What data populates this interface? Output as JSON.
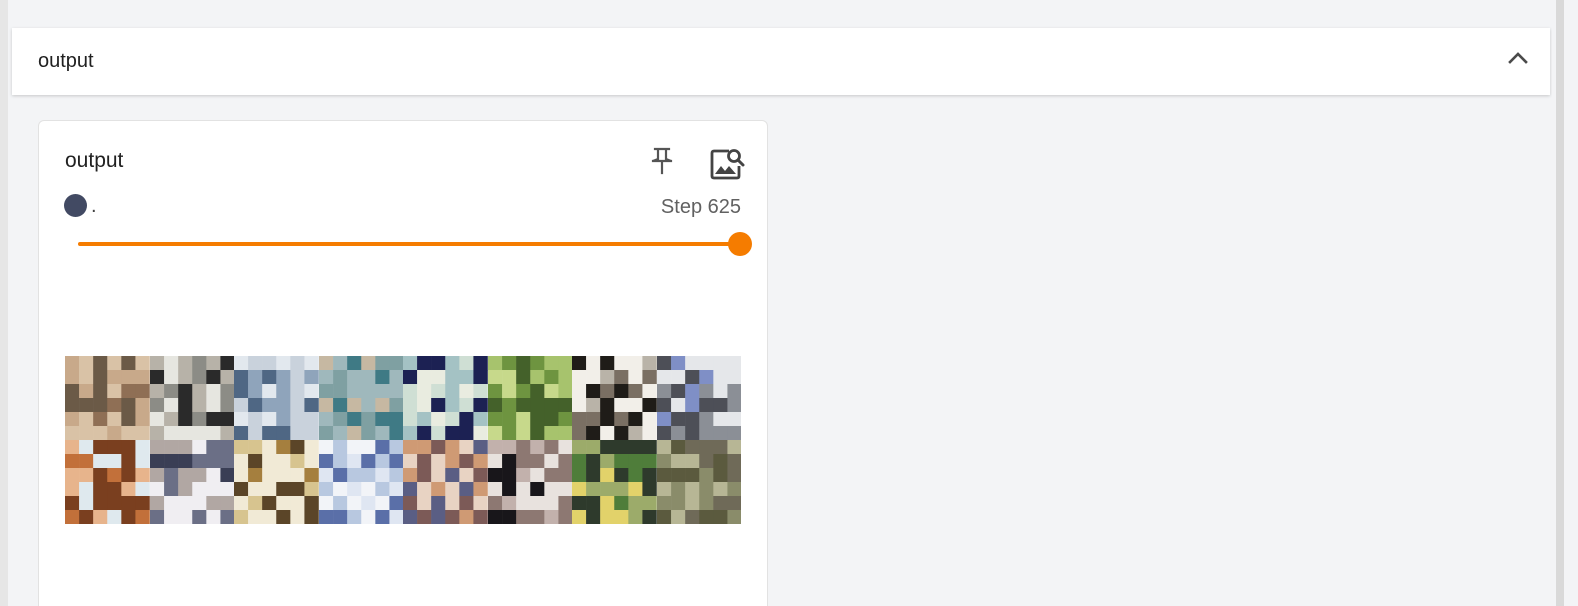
{
  "group": {
    "title": "output",
    "collapse_icon": "chevron-up-icon"
  },
  "card": {
    "title": "output",
    "pin_icon": "pin-icon",
    "zoom_icon": "image-search-icon",
    "run": {
      "label": ".",
      "color": "#424a63"
    },
    "step_label": "Step 625",
    "slider": {
      "value_fraction": 1.0,
      "color": "#f57c00"
    },
    "image": {
      "rows": 2,
      "cols": 8,
      "palettes": [
        [
          "#c8a98a",
          "#8f6f55",
          "#d9c2a6",
          "#6b5a47"
        ],
        [
          "#2a2a2a",
          "#e6e6e0",
          "#8c8c86",
          "#b7b2a8"
        ],
        [
          "#c9d2dc",
          "#8fa4bb",
          "#e2e8ee",
          "#4f6784"
        ],
        [
          "#7fa0a2",
          "#3f7a85",
          "#c6b8a2",
          "#9fb8bc"
        ],
        [
          "#cfdfd4",
          "#a4c2c4",
          "#1c2153",
          "#e9ece0"
        ],
        [
          "#a7c36d",
          "#6e9440",
          "#c7d98b",
          "#44612a"
        ],
        [
          "#1f1c18",
          "#f2efe9",
          "#7a6f63",
          "#b9b3a8"
        ],
        [
          "#7f8fc6",
          "#e5e7ea",
          "#8b8f96",
          "#4d4f57"
        ],
        [
          "#c2703a",
          "#7a3f1f",
          "#e7b48c",
          "#dfe9ee"
        ],
        [
          "#f0eef2",
          "#6b6f86",
          "#b1a7a3",
          "#3a3e55"
        ],
        [
          "#a57f3e",
          "#d7c48f",
          "#5b4528",
          "#f1ead6"
        ],
        [
          "#f2f4f8",
          "#b8c8e0",
          "#5a6fa8",
          "#dfe6f2"
        ],
        [
          "#cf9a74",
          "#7c5a57",
          "#e8d3c3",
          "#5a5e84"
        ],
        [
          "#18161a",
          "#e8e2de",
          "#8d7872",
          "#c2b1ac"
        ],
        [
          "#e2d26a",
          "#4f7d3a",
          "#9cab6a",
          "#2e3a2c"
        ],
        [
          "#8a8c6a",
          "#5b5a3e",
          "#b7b695",
          "#6f6a58"
        ]
      ]
    }
  }
}
